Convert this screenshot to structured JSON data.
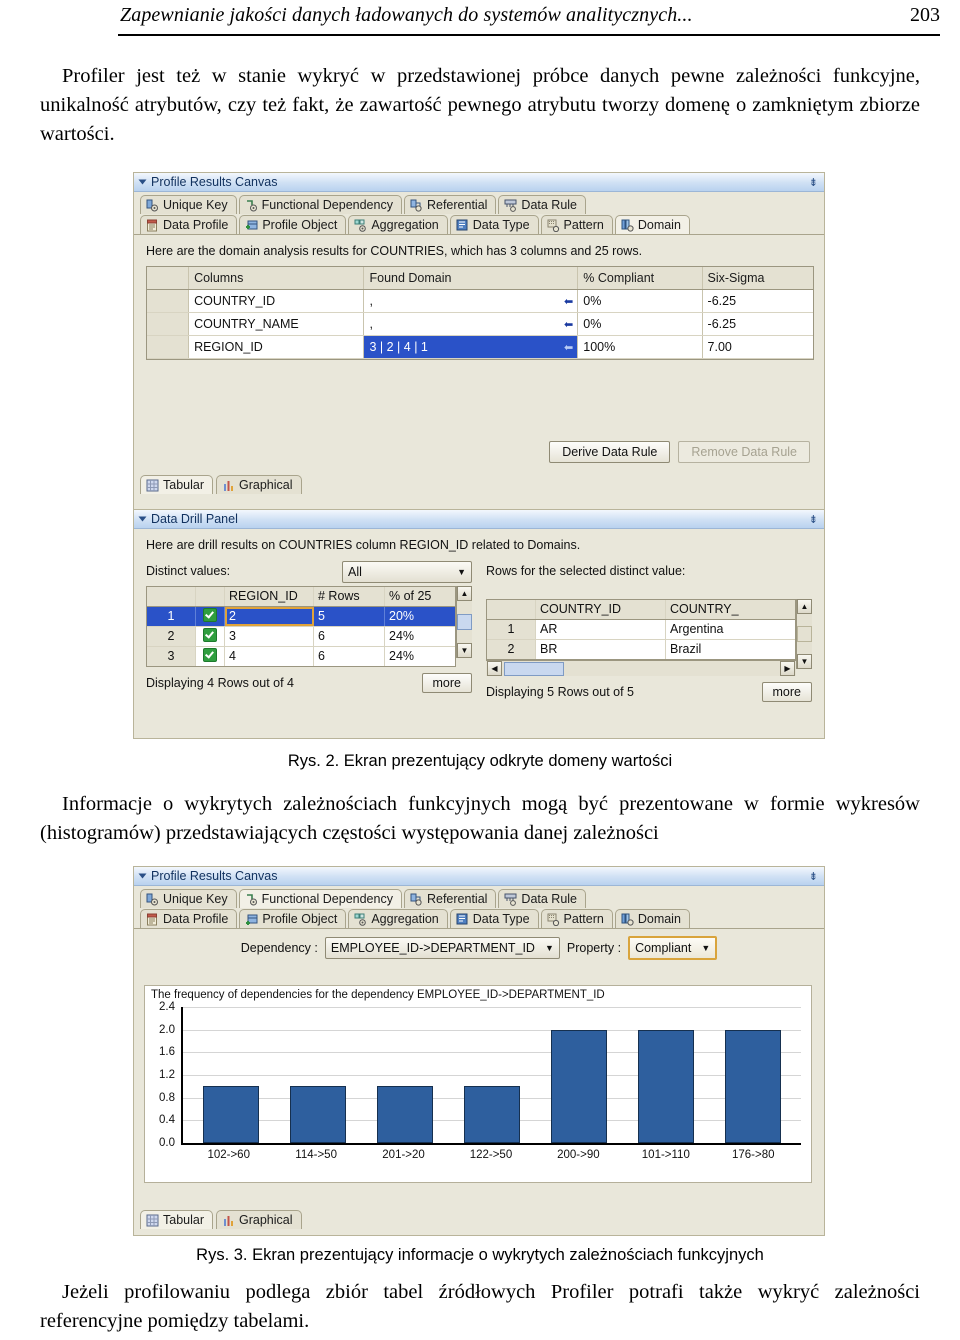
{
  "running_head": {
    "title": "Zapewnianie jakości danych ładowanych do systemów analitycznych...",
    "page_number": "203"
  },
  "body": {
    "para1": "Profiler jest też w stanie wykryć w przedstawionej próbce danych pewne zależności funkcyjne, unikalność atrybutów, czy też fakt, że zawartość pewnego atrybutu tworzy domenę o zamkniętym zbiorze wartości.",
    "caption2": "Rys. 2. Ekran prezentujący odkryte domeny wartości",
    "para2": "Informacje o wykrytych zależnościach funkcyjnych mogą być prezentowane w formie wykresów (histogramów) przedstawiających częstości występowania danej zależności",
    "caption3": "Rys. 3. Ekran prezentujący informacje o wykrytych zależnościach funkcyjnych",
    "para3": "Jeżeli profilowaniu podlega zbiór tabel źródłowych Profiler potrafi także wykryć zależności referencyjne pomiędzy tabelami."
  },
  "figure2": {
    "panel_title": "Profile Results Canvas",
    "tabs_row1": [
      {
        "label": "Unique Key",
        "icon": "unique-key-icon",
        "active": false
      },
      {
        "label": "Functional Dependency",
        "icon": "functional-dependency-icon",
        "active": false
      },
      {
        "label": "Referential",
        "icon": "referential-icon",
        "active": false
      },
      {
        "label": "Data Rule",
        "icon": "data-rule-icon",
        "active": false
      }
    ],
    "tabs_row2": [
      {
        "label": "Data Profile",
        "icon": "data-profile-icon",
        "active": false
      },
      {
        "label": "Profile Object",
        "icon": "profile-object-icon",
        "active": false
      },
      {
        "label": "Aggregation",
        "icon": "aggregation-icon",
        "active": false
      },
      {
        "label": "Data Type",
        "icon": "data-type-icon",
        "active": false
      },
      {
        "label": "Pattern",
        "icon": "pattern-icon",
        "active": false
      },
      {
        "label": "Domain",
        "icon": "domain-icon",
        "active": true
      }
    ],
    "info_line": "Here are the domain analysis results for COUNTRIES, which has 3 columns and 25 rows.",
    "table": {
      "headers": [
        "",
        "Columns",
        "Found Domain",
        "% Compliant",
        "Six-Sigma"
      ],
      "rows": [
        {
          "column": "COUNTRY_ID",
          "found_domain": ",",
          "compliant": "0%",
          "six_sigma": "-6.25",
          "selected": false
        },
        {
          "column": "COUNTRY_NAME",
          "found_domain": ",",
          "compliant": "0%",
          "six_sigma": "-6.25",
          "selected": false
        },
        {
          "column": "REGION_ID",
          "found_domain": "3 | 2 | 4 | 1",
          "compliant": "100%",
          "six_sigma": "7.00",
          "selected": true
        }
      ]
    },
    "buttons": {
      "derive": "Derive Data Rule",
      "remove": "Remove Data Rule"
    },
    "view_tabs": [
      {
        "label": "Tabular",
        "icon": "table-icon",
        "active": true
      },
      {
        "label": "Graphical",
        "icon": "bar-chart-icon",
        "active": false
      }
    ],
    "drill": {
      "panel_title": "Data Drill Panel",
      "info_line": "Here are drill results on COUNTRIES column REGION_ID related to Domains.",
      "left": {
        "label": "Distinct values:",
        "filter_value": "All",
        "headers": [
          "",
          "",
          "REGION_ID",
          "# Rows",
          "% of 25"
        ],
        "rows": [
          {
            "idx": "1",
            "value": "2",
            "rows": "5",
            "pct": "20%",
            "checked": true,
            "selected": true
          },
          {
            "idx": "2",
            "value": "3",
            "rows": "6",
            "pct": "24%",
            "checked": true,
            "selected": false
          },
          {
            "idx": "3",
            "value": "4",
            "rows": "6",
            "pct": "24%",
            "checked": true,
            "selected": false
          }
        ],
        "footer": "Displaying 4 Rows out of 4",
        "more_label": "more"
      },
      "right": {
        "label": "Rows for the selected distinct value:",
        "headers": [
          "",
          "COUNTRY_ID",
          "COUNTRY_"
        ],
        "rows": [
          {
            "idx": "1",
            "country_id": "AR",
            "country_name": "Argentina"
          },
          {
            "idx": "2",
            "country_id": "BR",
            "country_name": "Brazil"
          }
        ],
        "footer": "Displaying 5 Rows out of 5",
        "more_label": "more"
      }
    }
  },
  "figure3": {
    "panel_title": "Profile Results Canvas",
    "tabs_row1": [
      {
        "label": "Unique Key",
        "icon": "unique-key-icon",
        "active": false
      },
      {
        "label": "Functional Dependency",
        "icon": "functional-dependency-icon",
        "active": true
      },
      {
        "label": "Referential",
        "icon": "referential-icon",
        "active": false
      },
      {
        "label": "Data Rule",
        "icon": "data-rule-icon",
        "active": false
      }
    ],
    "tabs_row2": [
      {
        "label": "Data Profile",
        "icon": "data-profile-icon",
        "active": false
      },
      {
        "label": "Profile Object",
        "icon": "profile-object-icon",
        "active": false
      },
      {
        "label": "Aggregation",
        "icon": "aggregation-icon",
        "active": false
      },
      {
        "label": "Data Type",
        "icon": "data-type-icon",
        "active": false
      },
      {
        "label": "Pattern",
        "icon": "pattern-icon",
        "active": false
      },
      {
        "label": "Domain",
        "icon": "domain-icon",
        "active": false
      }
    ],
    "dependency_label": "Dependency :",
    "dependency_value": "EMPLOYEE_ID->DEPARTMENT_ID",
    "property_label": "Property :",
    "property_value": "Compliant",
    "view_tabs": [
      {
        "label": "Tabular",
        "icon": "table-icon",
        "active": true
      },
      {
        "label": "Graphical",
        "icon": "bar-chart-icon",
        "active": false
      }
    ]
  },
  "colors": {
    "bar_fill": "#2e5f9e",
    "bar_stroke": "#16304f",
    "selection_blue": "#2a52c8",
    "panel_beige": "#e9e7da",
    "focus_gold": "#d9a43c"
  },
  "chart_data": {
    "type": "bar",
    "title": "The frequency of dependencies for the dependency EMPLOYEE_ID->DEPARTMENT_ID",
    "categories": [
      "102->60",
      "114->50",
      "201->20",
      "122->50",
      "200->90",
      "101->110",
      "176->80"
    ],
    "values": [
      1.0,
      1.0,
      1.0,
      1.0,
      2.0,
      2.0,
      2.0
    ],
    "xlabel": "",
    "ylabel": "",
    "ylim": [
      0.0,
      2.4
    ],
    "yticks": [
      "0.0",
      "0.4",
      "0.8",
      "1.2",
      "1.6",
      "2.0",
      "2.4"
    ],
    "grid": true,
    "legend": "none"
  }
}
